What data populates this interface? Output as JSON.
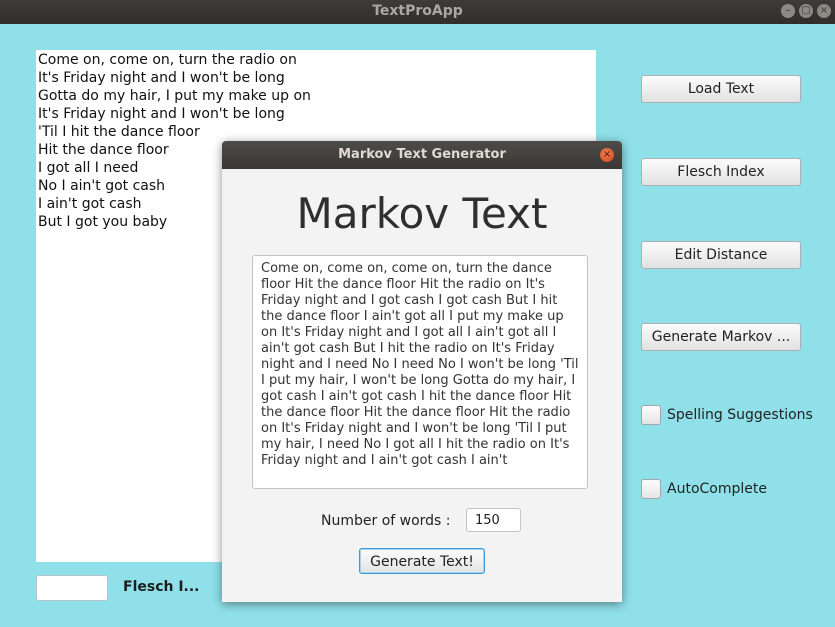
{
  "window": {
    "title": "TextProApp"
  },
  "main_text": {
    "lines": [
      "Come on, come on, turn the radio on",
      "It's Friday night and I won't be long",
      "Gotta do my hair, I put my make up on",
      "It's Friday night and I won't be long",
      "'Til I hit the dance floor",
      "Hit the dance floor",
      "I got all I need",
      "No I ain't got cash",
      "I ain't got cash",
      "But I got you baby"
    ]
  },
  "sidebar": {
    "load_text": "Load Text",
    "flesch_index": "Flesch Index",
    "edit_distance": "Edit Distance",
    "generate_markov": "Generate Markov ...",
    "spelling_suggestions": "Spelling Suggestions",
    "autocomplete": "AutoComplete"
  },
  "bottom": {
    "flesch_label": "Flesch I...",
    "flesch_value": ""
  },
  "dialog": {
    "title": "Markov Text Generator",
    "heading": "Markov Text",
    "generated_text": "Come on, come on, come on, turn the dance floor Hit the dance floor Hit the radio on It's Friday night and I got cash I got cash But I hit the dance floor I ain't got all I put my make up on It's Friday night and I got all I ain't got all I ain't got cash But I hit the radio on It's Friday night and I need No I need No I won't be long 'Til I put my hair, I won't be long Gotta do my hair, I got cash I ain't got cash I hit the dance floor Hit the dance floor Hit the dance floor Hit the radio on It's Friday night and I won't be long 'Til I put my hair, I need No I got all I hit the radio on It's Friday night and I ain't got cash I ain't",
    "num_words_label": "Number of words :",
    "num_words_value": "150",
    "generate_button": "Generate Text!"
  }
}
